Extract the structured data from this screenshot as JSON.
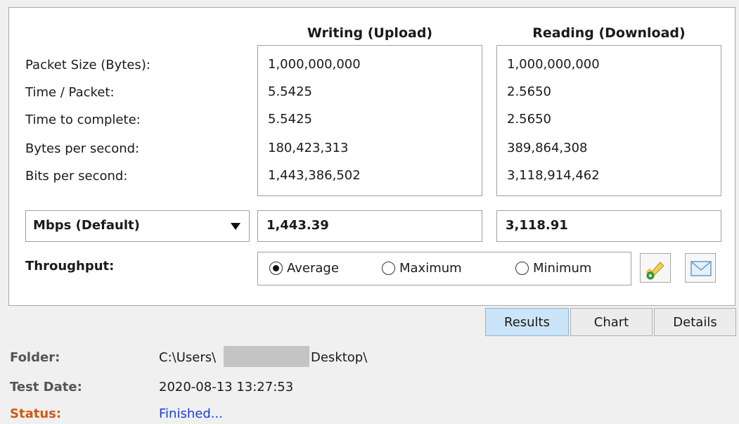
{
  "headers": {
    "writing": "Writing (Upload)",
    "reading": "Reading (Download)"
  },
  "rows": [
    {
      "label": "Packet Size (Bytes):",
      "writing": "1,000,000,000",
      "reading": "1,000,000,000"
    },
    {
      "label": "Time / Packet:",
      "writing": "5.5425",
      "reading": "2.5650"
    },
    {
      "label": "Time to complete:",
      "writing": "5.5425",
      "reading": "2.5650"
    },
    {
      "label": "Bytes per second:",
      "writing": "180,423,313",
      "reading": "389,864,308"
    },
    {
      "label": "Bits per second:",
      "writing": "1,443,386,502",
      "reading": "3,118,914,462"
    }
  ],
  "unit_select": {
    "value": "Mbps (Default)"
  },
  "result": {
    "writing": "1,443.39",
    "reading": "3,118.91"
  },
  "throughput": {
    "label": "Throughput:",
    "options": [
      "Average",
      "Maximum",
      "Minimum"
    ],
    "selected": "Average"
  },
  "icons": {
    "edit": "pencil-add-icon",
    "email": "envelope-icon"
  },
  "tabs": [
    "Results",
    "Chart",
    "Details"
  ],
  "active_tab": "Results",
  "info": {
    "folder_label": "Folder:",
    "folder_prefix": "C:\\Users\\",
    "folder_suffix": "Desktop\\",
    "date_label": "Test Date:",
    "date_value": "2020-08-13 13:27:53",
    "status_label": "Status:",
    "status_value": "Finished..."
  },
  "colors": {
    "status_label": "#d05a12",
    "status_value": "#1a3fd6",
    "active_tab": "#cce4f7"
  }
}
